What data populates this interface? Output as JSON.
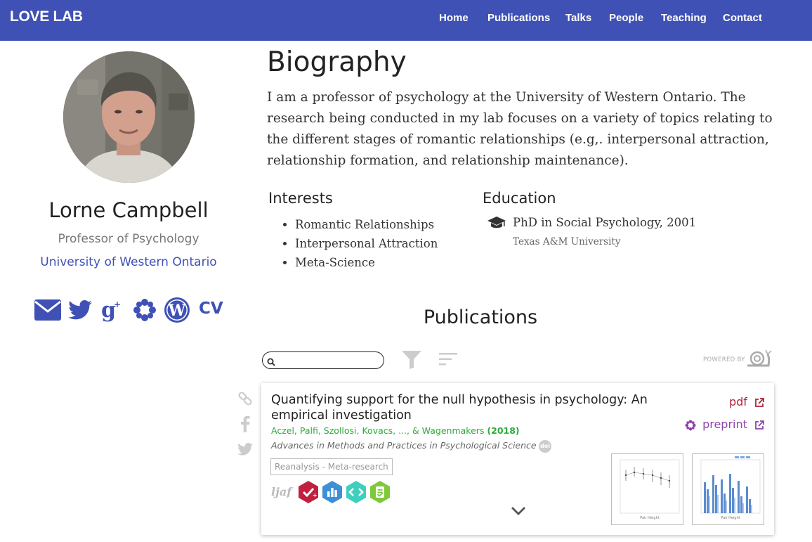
{
  "brand": "LOVE LAB",
  "nav": [
    "Home",
    "Publications",
    "Talks",
    "People",
    "Teaching",
    "Contact"
  ],
  "profile": {
    "name": "Lorne Campbell",
    "role": "Professor of Psychology",
    "organization": "University of Western Ontario",
    "social_icons": [
      "envelope-icon",
      "twitter-icon",
      "google-scholar-icon",
      "osf-icon",
      "wordpress-icon"
    ],
    "cv_label": "CV"
  },
  "biography": {
    "title": "Biography",
    "text": "I am a professor of psychology at the University of Western Ontario. The research being conducted in my lab focuses on a variety of topics relating to the different stages of romantic relationships (e.g,. interpersonal attraction, relationship formation, and relationship maintenance)."
  },
  "interests": {
    "title": "Interests",
    "items": [
      "Romantic Relationships",
      "Interpersonal Attraction",
      "Meta-Science"
    ]
  },
  "education": {
    "title": "Education",
    "degree": "PhD in Social Psychology, 2001",
    "institution": "Texas A&M University"
  },
  "publications": {
    "title": "Publications",
    "search_placeholder": "",
    "powered_by": "POWERED BY",
    "items": [
      {
        "title": "Quantifying support for the null hypothesis in psychology: An empirical investigation",
        "authors": "Aczel, Palfi, Szollosi, Kovacs, ..., & Wagenmakers",
        "year": "(2018)",
        "journal": "Advances in Methods and Practices in Psychological Science",
        "doi_label": "doi",
        "tag": "Reanalysis - Meta-research",
        "funder": "ljaf",
        "pdf_label": "pdf",
        "preprint_label": "preprint",
        "badges": [
          "preregistered-badge",
          "open-data-badge",
          "open-code-badge",
          "open-materials-badge"
        ],
        "thumb_xlabel": "Pair Height"
      }
    ]
  },
  "colors": {
    "primary": "#3f51b5",
    "authors": "#2eaa3c",
    "pdf": "#b0243a",
    "preprint": "#8e44ad"
  }
}
